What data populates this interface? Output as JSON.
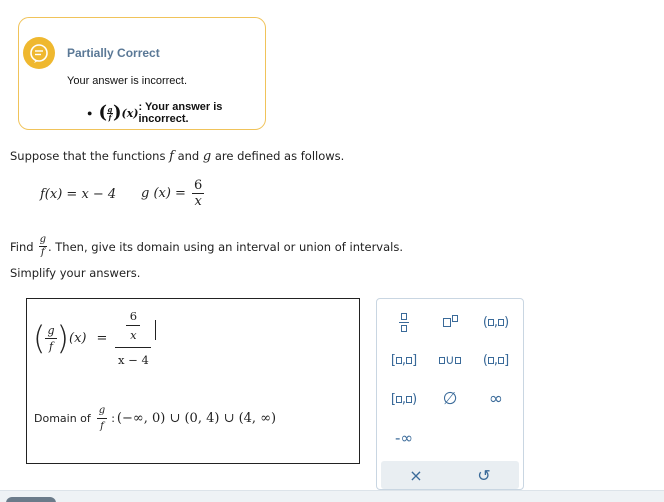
{
  "feedback": {
    "title": "Partially Correct",
    "message": "Your answer is incorrect.",
    "item_lhs_num": "g",
    "item_lhs_den": "f",
    "item_lhs_var": "(x)",
    "item_text": ": Your answer is incorrect.",
    "accent_color": "#efb82f"
  },
  "problem": {
    "intro": "Suppose that the functions",
    "f_name": "f",
    "and": "and",
    "g_name": "g",
    "intro_end": "are defined as follows.",
    "f_definition": "f(x) = x − 4",
    "g_lhs": "g (x) =",
    "g_num": "6",
    "g_den": "x",
    "find_label": "Find",
    "find_num": "g",
    "find_den": "f",
    "find_rest": ". Then, give its domain using an interval or union of intervals.",
    "simplify": "Simplify your answers."
  },
  "answer": {
    "lhs_num": "g",
    "lhs_den": "f",
    "lhs_var": "(x)",
    "equals": "=",
    "rhs_top_num": "6",
    "rhs_top_den": "x",
    "rhs_den": "x − 4",
    "domain_label": "Domain of",
    "domain_num": "g",
    "domain_den": "f",
    "domain_colon": ":",
    "domain_value": "(−∞, 0) ∪ (0, 4) ∪ (4, ∞)"
  },
  "keypad": {
    "empty_set": "∅",
    "infinity": "∞",
    "neg_infinity": "-∞",
    "clear": "×",
    "undo": "↺"
  }
}
